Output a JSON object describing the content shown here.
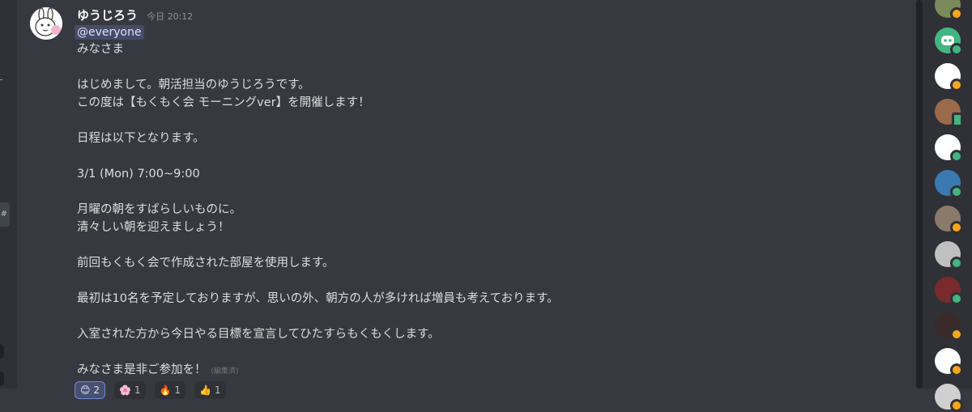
{
  "message": {
    "username": "ゆうじろう",
    "timestamp": "今日 20:12",
    "mention": "@everyone",
    "lines": [
      "みなさま",
      "",
      "はじめまして。朝活担当のゆうじろうです。",
      "この度は【もくもく会 モーニングver】を開催します！",
      "",
      "日程は以下となります。",
      "",
      "3/1 (Mon) 7:00~9:00",
      "",
      "月曜の朝をすばらしいものに。",
      "清々しい朝を迎えましょう！",
      "",
      "前回もくもく会で作成された部屋を使用します。",
      "",
      "最初は10名を予定しておりますが、思いの外、朝方の人が多ければ増員も考えております。",
      "",
      "入室された方から今日やる目標を宣言してひたすらもくもくします。",
      "",
      "みなさま是非ご参加を！"
    ],
    "edited_label": "(編集済)"
  },
  "reactions": [
    {
      "emoji": "😊",
      "count": "2"
    },
    {
      "emoji": "🌸",
      "count": "1"
    },
    {
      "emoji": "🔥",
      "count": "1"
    },
    {
      "emoji": "👍",
      "count": "1"
    }
  ],
  "left_strip": {
    "tag": "#"
  },
  "members": [
    {
      "name": "member-1",
      "status": "idle",
      "color": "#7a8a5a"
    },
    {
      "name": "member-discord",
      "status": "online",
      "color": "#43b581"
    },
    {
      "name": "member-3",
      "status": "idle",
      "color": "#ffffff"
    },
    {
      "name": "member-4",
      "status": "mobile",
      "color": "#9a6a4a"
    },
    {
      "name": "member-5",
      "status": "online",
      "color": "#ffffff"
    },
    {
      "name": "member-6",
      "status": "online",
      "color": "#3a7ab0"
    },
    {
      "name": "member-7",
      "status": "idle",
      "color": "#8a7a6a"
    },
    {
      "name": "member-8",
      "status": "online",
      "color": "#c0c0c0"
    },
    {
      "name": "member-9",
      "status": "online",
      "color": "#7a2a2a"
    },
    {
      "name": "member-10",
      "status": "idle",
      "color": "#3a2a2a"
    },
    {
      "name": "member-11",
      "status": "idle",
      "color": "#ffffff"
    },
    {
      "name": "member-12",
      "status": "idle",
      "color": "#d0d0d0"
    }
  ]
}
